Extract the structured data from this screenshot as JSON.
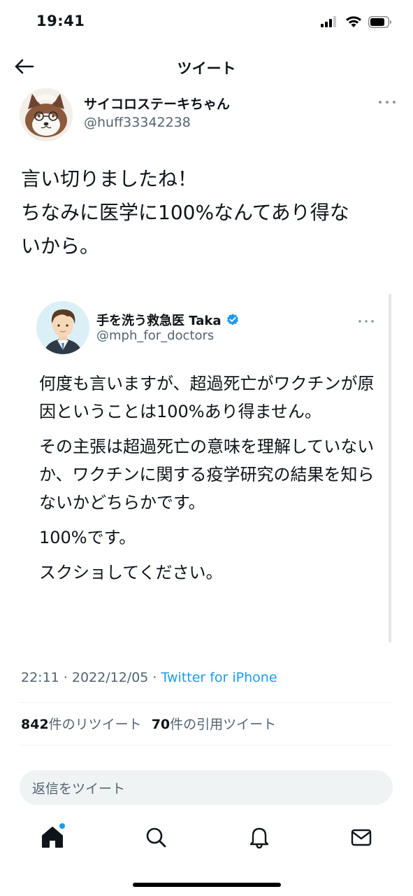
{
  "status_bar": {
    "time": "19:41"
  },
  "nav": {
    "title": "ツイート"
  },
  "tweet": {
    "author_name": "サイコロステーキちゃん",
    "author_handle": "@huff33342238",
    "text_lines": [
      "言い切りましたね！",
      "ちなみに医学に100%なんてあり得な",
      "いから。"
    ],
    "timestamp": "22:11 · 2022/12/05 · ",
    "source": "Twitter for iPhone"
  },
  "quoted_tweet": {
    "author_name": "手を洗う救急医 Taka",
    "author_handle": "@mph_for_doctors",
    "paragraphs": [
      "何度も言いますが、超過死亡がワクチンが原因ということは100%あり得ません。",
      "その主張は超過死亡の意味を理解していないか、ワクチンに関する疫学研究の結果を知らないかどちらかです。",
      "100%です。",
      "スクショしてください。"
    ]
  },
  "stats": {
    "retweets_count": "842",
    "retweets_label": "件のリツイート",
    "quotes_count": "70",
    "quotes_label": "件の引用ツイート"
  },
  "reply": {
    "placeholder": "返信をツイート"
  },
  "tabbar": {
    "items": [
      "home-icon",
      "search-icon",
      "notifications-icon",
      "messages-icon"
    ],
    "notification_dot_color": "#1d9bf0"
  },
  "colors": {
    "text": "#0f1419",
    "secondary": "#536471",
    "accent": "#1d9bf0"
  }
}
